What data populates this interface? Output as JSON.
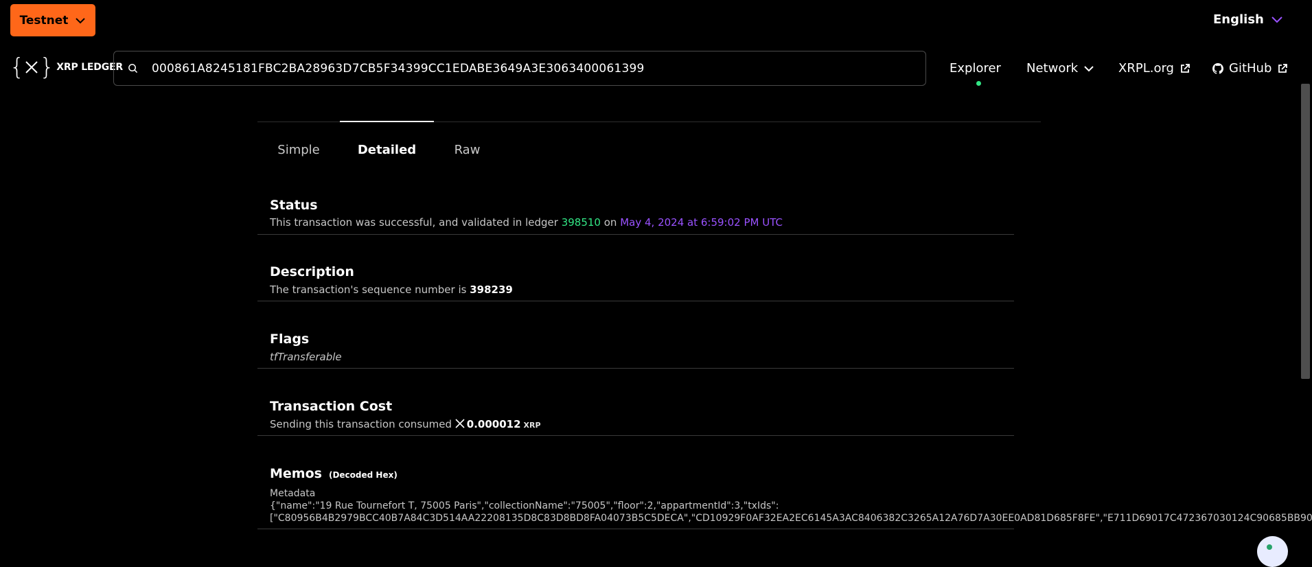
{
  "network_switcher": {
    "label": "Testnet"
  },
  "language": {
    "label": "English"
  },
  "logo": {
    "mark": "{ }",
    "text": "XRP LEDGER"
  },
  "search": {
    "value": "000861A8245181FBC2BA28963D7CB5F34399CC1EDABE3649A3E3063400061399"
  },
  "nav": {
    "explorer": "Explorer",
    "network": "Network",
    "xrpl": "XRPL.org",
    "github": "GitHub"
  },
  "tabs": [
    {
      "label": "Simple",
      "active": false
    },
    {
      "label": "Detailed",
      "active": true
    },
    {
      "label": "Raw",
      "active": false
    }
  ],
  "status": {
    "title": "Status",
    "prefix": "This transaction was successful, and validated in ledger",
    "ledger": "398510",
    "on": "on",
    "date": "May 4, 2024 at 6:59:02 PM UTC"
  },
  "description": {
    "title": "Description",
    "prefix": "The transaction's sequence number is",
    "sequence": "398239"
  },
  "flags": {
    "title": "Flags",
    "value": "tfTransferable"
  },
  "cost": {
    "title": "Transaction Cost",
    "prefix": "Sending this transaction consumed",
    "amount": "0.000012",
    "unit": "XRP"
  },
  "memos": {
    "title": "Memos",
    "decoded_label": "(Decoded Hex)",
    "type": "Metadata",
    "line1": "{\"name\":\"19 Rue Tournefort T, 75005 Paris\",\"collectionName\":\"75005\",\"floor\":2,\"appartmentId\":3,\"txIds\":",
    "line2": "[\"C80956B4B2979BCC40B7A84C3D514AA22208135D8C83D8BD8FA04073B5C5DECA\",\"CD10929F0AF32EA2EC6145A3AC8406382C3265A12A76D7A30EE0AD81D685F8FE\",\"E711D69017C472367030124C90685BB90"
  },
  "colors": {
    "accent_orange": "#FF6719",
    "success_green": "#32E685",
    "link_purple": "#9A52FF"
  },
  "icons": [
    "chevron-down-icon",
    "search-icon",
    "external-link-icon",
    "github-icon",
    "xrp-icon"
  ]
}
